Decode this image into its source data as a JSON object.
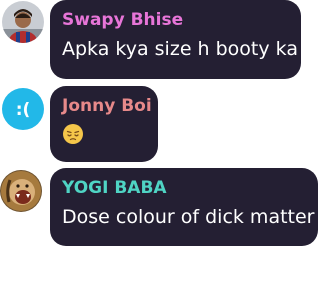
{
  "messages": [
    {
      "sender": "Swapy Bhise",
      "sender_color": "#e775d8",
      "text": "Apka kya size h booty ka",
      "avatar": "person-photo-avatar"
    },
    {
      "sender": "Jonny Boi",
      "sender_color": "#e7898a",
      "text": "",
      "emoji": "pensive-face-emoji",
      "avatar": "sad-face-avatar",
      "avatar_text": ":("
    },
    {
      "sender": "YOGI BABA",
      "sender_color": "#4fd4c4",
      "text": "Dose colour of dick matter",
      "avatar": "roaring-lion-avatar"
    }
  ],
  "colors": {
    "bubble_bg": "#241f33",
    "message_text": "#ffffff",
    "sad_avatar_bg": "#22b8e8"
  }
}
